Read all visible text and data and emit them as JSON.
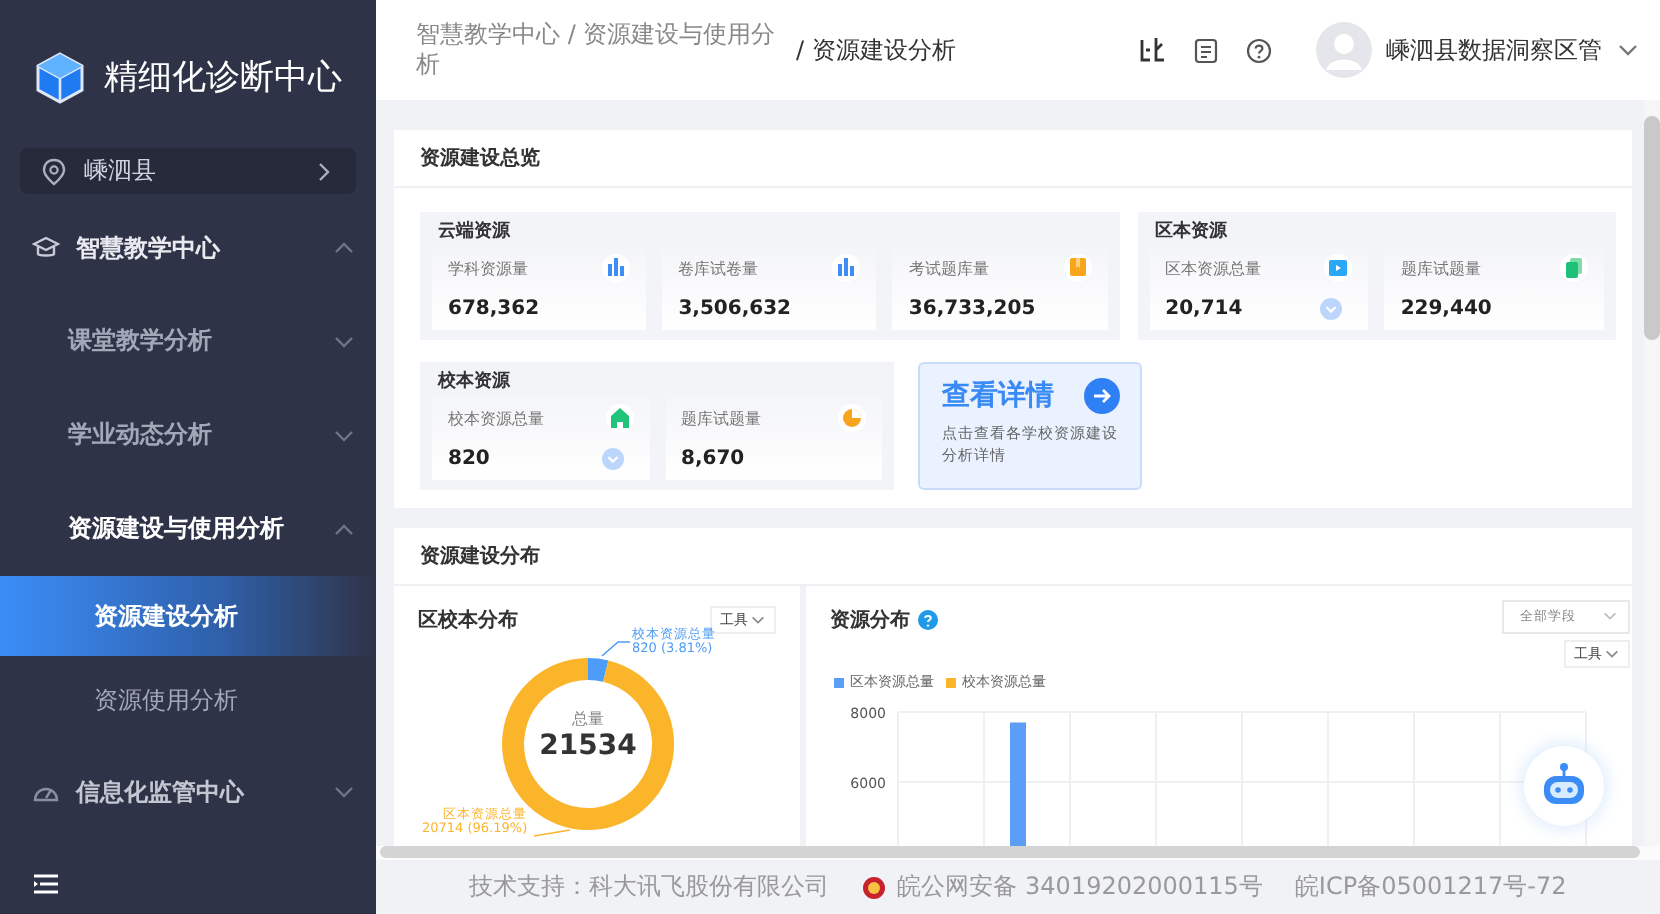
{
  "sidebar": {
    "title": "精细化诊断中心",
    "location": "嵊泗县",
    "menu": [
      {
        "label": "智慧教学中心",
        "kind": "cap",
        "expanded": true,
        "children": [
          {
            "label": "课堂教学分析",
            "expanded": false
          },
          {
            "label": "学业动态分析",
            "expanded": false
          },
          {
            "label": "资源建设与使用分析",
            "expanded": true,
            "children": [
              {
                "label": "资源建设分析",
                "selected": true
              },
              {
                "label": "资源使用分析",
                "selected": false
              }
            ]
          }
        ]
      },
      {
        "label": "信息化监管中心",
        "kind": "gauge",
        "expanded": false
      }
    ]
  },
  "header": {
    "breadcrumb": [
      "智慧教学中心 / 资源建设与使用分析",
      "/ 资源建设分析"
    ],
    "user": "嵊泗县数据洞察区管"
  },
  "overview": {
    "title": "资源建设总览",
    "groups": [
      {
        "title": "云端资源",
        "items": [
          {
            "label": "学科资源量",
            "value": "678,362",
            "kind": "bars",
            "expandable": false
          },
          {
            "label": "卷库试卷量",
            "value": "3,506,632",
            "kind": "bars",
            "expandable": false
          },
          {
            "label": "考试题库量",
            "value": "36,733,205",
            "kind": "book",
            "expandable": false
          }
        ]
      },
      {
        "title": "区本资源",
        "items": [
          {
            "label": "区本资源总量",
            "value": "20,714",
            "kind": "play",
            "expandable": true
          },
          {
            "label": "题库试题量",
            "value": "229,440",
            "kind": "doc",
            "expandable": false
          }
        ]
      },
      {
        "title": "校本资源",
        "items": [
          {
            "label": "校本资源总量",
            "value": "820",
            "kind": "house",
            "expandable": true
          },
          {
            "label": "题库试题量",
            "value": "8,670",
            "kind": "pie",
            "expandable": false
          }
        ]
      }
    ],
    "details": {
      "title": "查看详情",
      "text": "点击查看各学校资源建设分析详情"
    }
  },
  "distribution": {
    "title": "资源建设分布",
    "share": {
      "title": "区校本分布",
      "tool": "工具",
      "center_label": "总量",
      "center_value": "21534",
      "chart_data": {
        "type": "donut",
        "categories": [
          "校本资源总量",
          "区本资源总量"
        ],
        "values": [
          820,
          20714
        ],
        "colors": [
          "#4d9cf8",
          "#fbb52b"
        ],
        "value_labels": [
          "820 (3.81%)",
          "20714 (96.19%)"
        ]
      }
    },
    "resources": {
      "title": "资源分布",
      "select": "全部学段",
      "tool": "工具",
      "chart_data": {
        "type": "bar",
        "ylim": [
          0,
          8000
        ],
        "yticks": [
          6000,
          8000
        ],
        "series": [
          {
            "name": "区本资源总量",
            "color": "#5a9ef8",
            "values": [
              null,
              7700,
              null,
              null,
              null,
              null,
              null,
              null
            ]
          },
          {
            "name": "校本资源总量",
            "color": "#fbb52b",
            "values": [
              null,
              null,
              null,
              null,
              null,
              null,
              null,
              null
            ]
          }
        ]
      }
    }
  },
  "footer": {
    "support": "技术支持：科大讯飞股份有限公司",
    "police": "皖公网安备 34019202000115号",
    "icp": "皖ICP备05001217号-72"
  }
}
